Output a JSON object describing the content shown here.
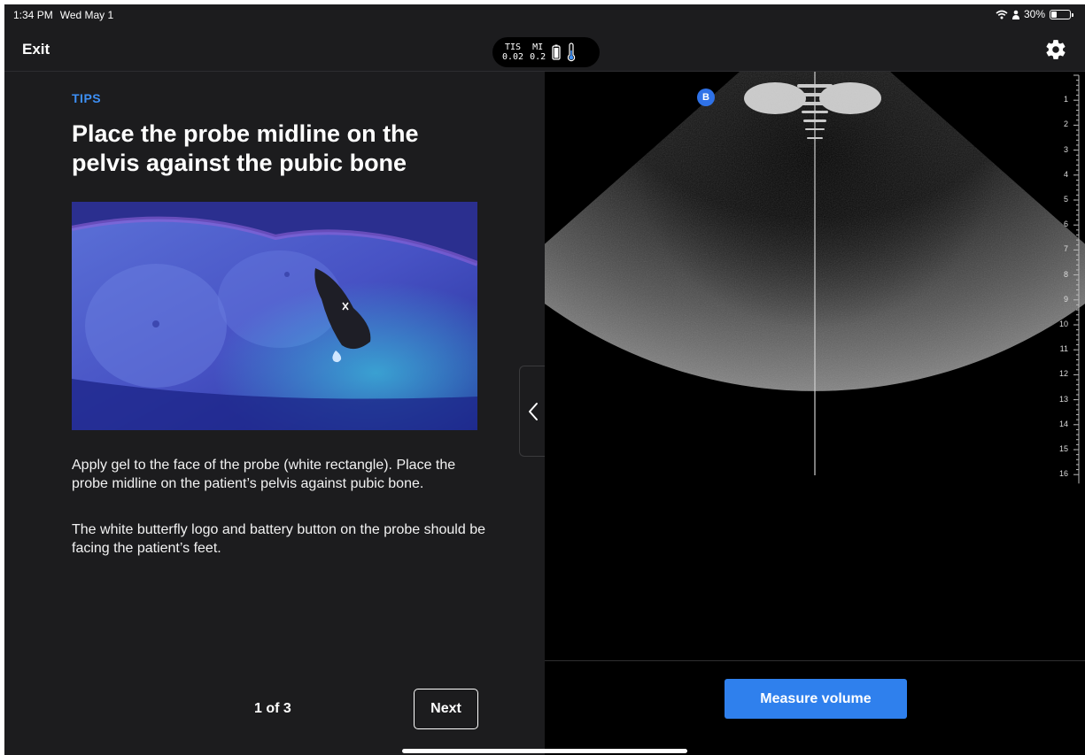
{
  "status_bar": {
    "time": "1:34 PM",
    "date": "Wed May 1",
    "battery": "30%",
    "battery_level": 0.3
  },
  "nav": {
    "exit_label": "Exit",
    "metrics": [
      {
        "label": "TIS",
        "value": "0.02"
      },
      {
        "label": "MI",
        "value": "0.2"
      }
    ],
    "icons": [
      "probe-battery-icon",
      "thermometer-icon",
      "gear-icon"
    ]
  },
  "tips": {
    "section_label": "TIPS",
    "title": "Place the probe midline on the pelvis against the pubic bone",
    "paragraph_1": "Apply gel to the face of the probe (white rectangle). Place the probe midline on the patient’s pelvis against pubic bone.",
    "paragraph_2": "The white butterfly logo and battery button on the probe should be facing the patient’s feet.",
    "pager": "1 of 3",
    "next_label": "Next"
  },
  "ultrasound": {
    "mode": "B",
    "depth_scale": [
      "1",
      "2",
      "3",
      "4",
      "5",
      "6",
      "7",
      "8",
      "9",
      "10",
      "11",
      "12",
      "13",
      "14",
      "15",
      "16"
    ]
  },
  "actions": {
    "measure_label": "Measure volume"
  },
  "colors": {
    "accent": "#3d8ff5",
    "button_blue": "#2f80ed",
    "panel_bg": "#1c1c1e"
  }
}
